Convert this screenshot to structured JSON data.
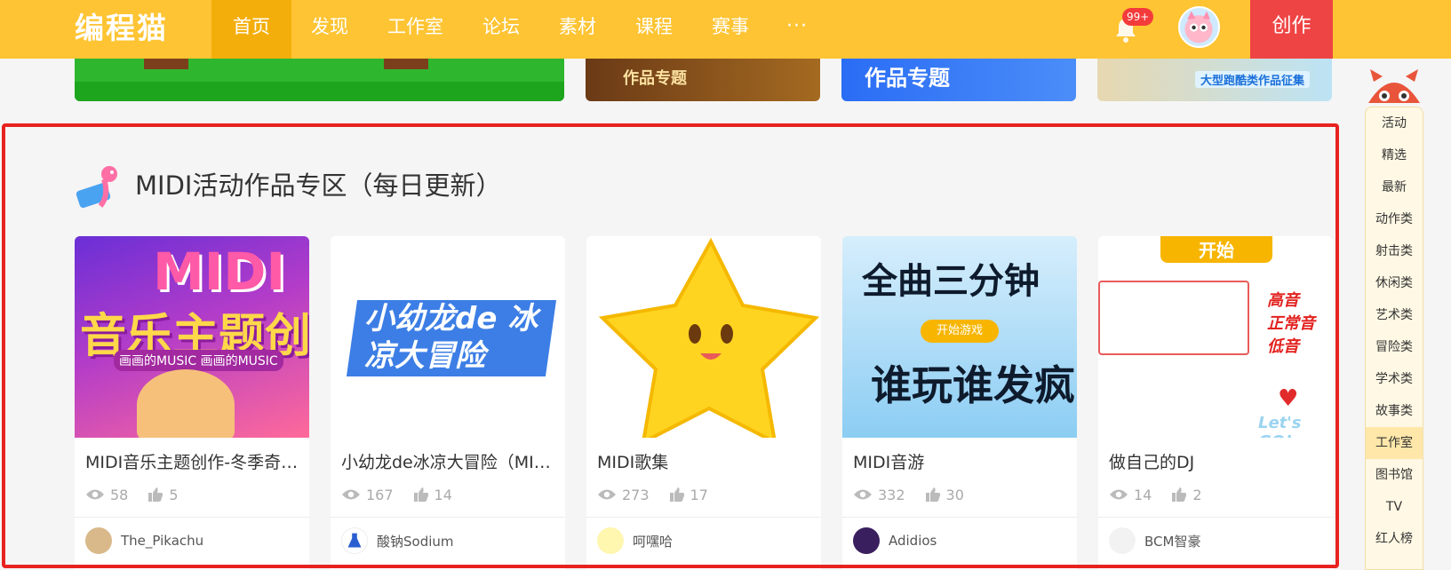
{
  "header": {
    "logo": "编程猫",
    "nav": [
      "首页",
      "发现",
      "工作室",
      "论坛",
      "素材",
      "课程",
      "赛事"
    ],
    "more": "···",
    "notify_badge": "99+",
    "create_label": "创作"
  },
  "banners": {
    "b2": "作品专题",
    "b3": "作品专题",
    "b4": "大型跑酷类作品征集"
  },
  "section": {
    "title": "MIDI活动作品专区（每日更新）"
  },
  "cards": [
    {
      "title": "MIDI音乐主题创作-冬季奇…",
      "views": "58",
      "likes": "5",
      "author": "The_Pikachu",
      "thumb_text": {
        "midi": "MIDI",
        "big": "音乐主题创作",
        "sub": "画画的MUSIC  画画的MUSIC"
      }
    },
    {
      "title": "小幼龙de冰凉大冒险（MID…",
      "views": "167",
      "likes": "14",
      "author": "酸钠Sodium",
      "thumb_text": {
        "line": "小幼龙de 冰凉大冒险"
      }
    },
    {
      "title": "MIDI歌集",
      "views": "273",
      "likes": "17",
      "author": "呵嘿哈"
    },
    {
      "title": "MIDI音游",
      "views": "332",
      "likes": "30",
      "author": "Adidios",
      "thumb_text": {
        "l1": "全曲三分钟",
        "btn": "开始游戏",
        "l2": "谁玩谁发疯"
      }
    },
    {
      "title": "做自己的DJ",
      "views": "14",
      "likes": "2",
      "author": "BCM智豪",
      "thumb_text": {
        "start": "开始",
        "r1": "高音",
        "r2": "正常音",
        "r3": "低音",
        "lets": "Let's GO!"
      }
    }
  ],
  "sidebar": {
    "items": [
      "活动",
      "精选",
      "最新",
      "动作类",
      "射击类",
      "休闲类",
      "艺术类",
      "冒险类",
      "学术类",
      "故事类",
      "工作室",
      "图书馆",
      "TV",
      "红人榜"
    ],
    "active": "工作室"
  },
  "colors": {
    "header_bg": "#fec433",
    "nav_active_bg": "#f4ae0b",
    "create_bg": "#ef4444",
    "selection_border": "#e8221f"
  }
}
